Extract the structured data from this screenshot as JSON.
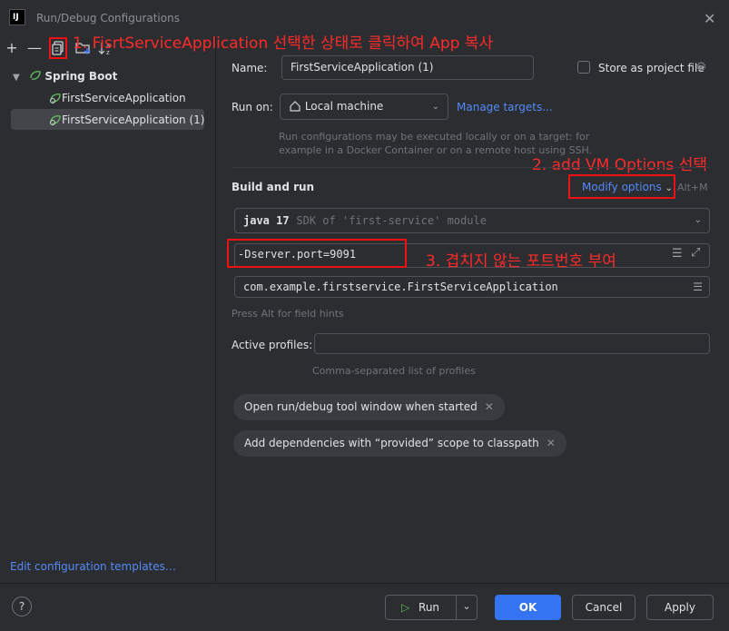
{
  "window": {
    "title": "Run/Debug Configurations",
    "app_icon_text": "IJ"
  },
  "toolbar": {
    "add": "+",
    "remove": "—",
    "copy": "⧉",
    "folder": "⊞",
    "sort": "↓ª"
  },
  "tree": {
    "group_label": "Spring Boot",
    "items": [
      {
        "label": "FirstServiceApplication"
      },
      {
        "label": "FirstServiceApplication (1)"
      }
    ]
  },
  "left_footer": {
    "edit_templates": "Edit configuration templates…"
  },
  "form": {
    "name_label": "Name:",
    "name_value": "FirstServiceApplication (1)",
    "store_label": "Store as project file",
    "run_on_label": "Run on:",
    "run_on_value": "Local machine",
    "manage_targets": "Manage targets...",
    "run_hint_1": "Run configurations may be executed locally or on a target: for",
    "run_hint_2": "example in a Docker Container or on a remote host using SSH.",
    "build_run_title": "Build and run",
    "modify_options": "Modify options",
    "modify_shortcut": "Alt+M",
    "sdk_main": "java 17",
    "sdk_sub": "SDK of 'first-service' module",
    "vm_options": "-Dserver.port=9091",
    "main_class": "com.example.firstservice.FirstServiceApplication",
    "field_hint": "Press Alt for field hints",
    "active_profiles_label": "Active profiles:",
    "profiles_hint": "Comma-separated list of profiles",
    "chip_1": "Open run/debug tool window when started",
    "chip_2": "Add dependencies with “provided” scope to classpath"
  },
  "annotations": {
    "step1": "1. FisrtServiceApplication 선택한 상태로 클릭하여 App 복사",
    "step2": "2. add VM Options 선택",
    "step3": "3. 겹치지 않는 포트번호 부여"
  },
  "footer": {
    "help": "?",
    "run": "Run",
    "ok": "OK",
    "cancel": "Cancel",
    "apply": "Apply"
  }
}
